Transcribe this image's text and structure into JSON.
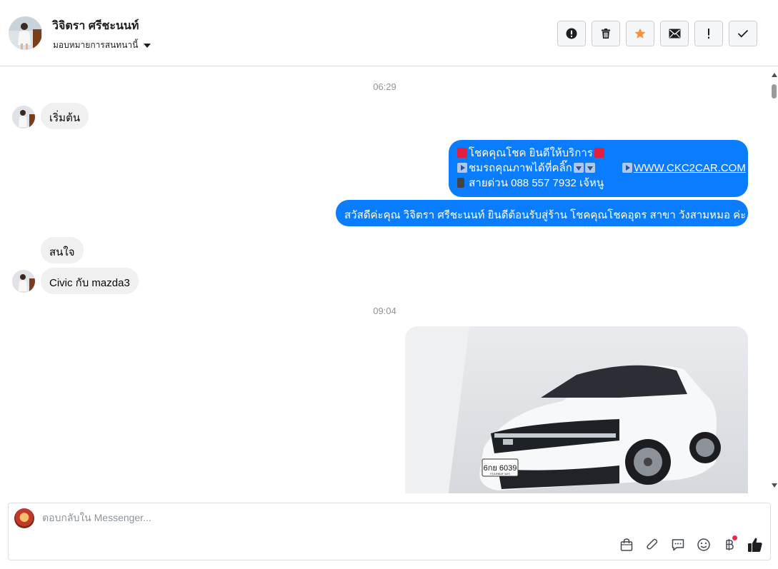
{
  "header": {
    "contact_name": "วิจิตรา ศรีชะนนท์",
    "assign_label": "มอบหมายการสนทนานี้",
    "actions": [
      {
        "name": "spam-alert-button",
        "icon": "exclamation-circle-icon"
      },
      {
        "name": "delete-button",
        "icon": "trash-icon"
      },
      {
        "name": "star-button",
        "icon": "star-icon",
        "color": "#f7923a"
      },
      {
        "name": "mark-unread-button",
        "icon": "envelope-icon"
      },
      {
        "name": "follow-up-button",
        "icon": "exclamation-icon"
      },
      {
        "name": "mark-done-button",
        "icon": "checkmark-icon"
      }
    ]
  },
  "conversation": {
    "time_1": "06:29",
    "msg_in_1": "เริ่มต้น",
    "msg_out_greeting": {
      "line1": "โชคคุณโชค ยินดีให้บริการ",
      "line2_text": "ชมรถคุณภาพได้ที่คลิ๊ก",
      "line2_link": "WWW.CKC2CAR.COM",
      "line3": "สายด่วน 088 557 7932 เจ้หนู"
    },
    "msg_out_welcome": "สวัสดีค่ะคุณ วิจิตรา ศรีชะนนท์ ยินดีต้อนรับสู่ร้าน โชคคุณโชคอุดร สาขา วังสามหมอ ค่ะ",
    "msg_in_2": "สนใจ",
    "msg_in_3": "Civic กับ mazda3",
    "time_2": "09:04",
    "photo": {
      "plate_text": "6กย 6039",
      "plate_province": "กรุงเทพมหานคร"
    }
  },
  "composer": {
    "placeholder": "ตอบกลับใน Messenger...",
    "icons": [
      "shopping-bag-icon",
      "paperclip-icon",
      "saved-replies-icon",
      "emoji-icon",
      "baht-payment-icon",
      "thumbs-up-icon"
    ]
  },
  "colors": {
    "outgoing_bubble": "#0a7cff",
    "incoming_bubble": "#f0f0f0",
    "star": "#f7923a",
    "notification_dot": "#f02849"
  }
}
